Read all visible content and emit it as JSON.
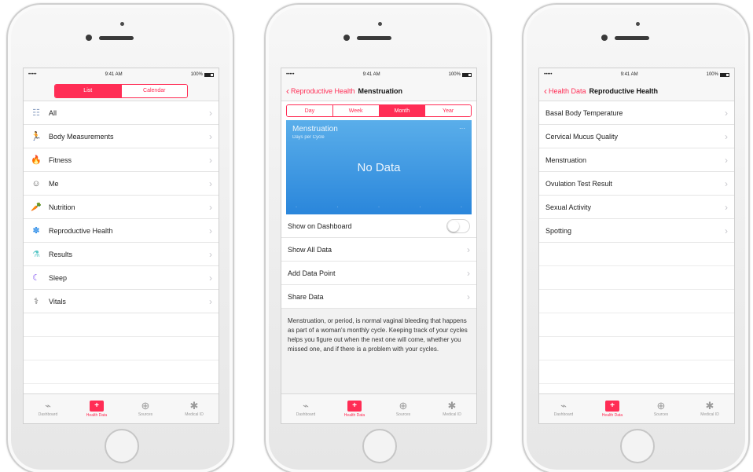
{
  "phone1": {
    "status": {
      "carrier": "•••••",
      "time": "9:41 AM",
      "battery": "100%"
    },
    "segments": [
      {
        "label": "List",
        "active": true
      },
      {
        "label": "Calendar",
        "active": false
      }
    ],
    "categories": [
      {
        "label": "All",
        "icon": "all-icon",
        "glyph": "☷",
        "color": "#8fa3c4"
      },
      {
        "label": "Body Measurements",
        "icon": "body-measurements-icon",
        "glyph": "🏃",
        "color": "#f5a623"
      },
      {
        "label": "Fitness",
        "icon": "fitness-flame-icon",
        "glyph": "🔥",
        "color": "#ff3b30"
      },
      {
        "label": "Me",
        "icon": "me-icon",
        "glyph": "☺",
        "color": "#555555"
      },
      {
        "label": "Nutrition",
        "icon": "nutrition-carrot-icon",
        "glyph": "🥕",
        "color": "#ff9500"
      },
      {
        "label": "Reproductive Health",
        "icon": "reproductive-health-icon",
        "glyph": "✽",
        "color": "#2d8de8"
      },
      {
        "label": "Results",
        "icon": "results-flask-icon",
        "glyph": "⚗",
        "color": "#5ac8c8"
      },
      {
        "label": "Sleep",
        "icon": "sleep-moon-icon",
        "glyph": "☾",
        "color": "#7d4ff0"
      },
      {
        "label": "Vitals",
        "icon": "vitals-stethoscope-icon",
        "glyph": "⚕",
        "color": "#666666"
      }
    ]
  },
  "phone2": {
    "status": {
      "carrier": "•••••",
      "time": "9:41 AM",
      "battery": "100%"
    },
    "back_label": "Reproductive Health",
    "title": "Menstruation",
    "periods": [
      {
        "label": "Day",
        "active": false
      },
      {
        "label": "Week",
        "active": false
      },
      {
        "label": "Month",
        "active": true
      },
      {
        "label": "Year",
        "active": false
      }
    ],
    "chart": {
      "title": "Menstruation",
      "subtitle": "Days per Cycle",
      "no_data": "No Data"
    },
    "rows": {
      "show_on_dashboard": "Show on Dashboard",
      "show_all_data": "Show All Data",
      "add_data_point": "Add Data Point",
      "share_data": "Share Data"
    },
    "description": "Menstruation, or period, is normal vaginal bleeding that happens as part of a woman's monthly cycle. Keeping track of your cycles helps you figure out when the next one will come, whether you missed one, and if there is a problem with your cycles."
  },
  "phone3": {
    "status": {
      "carrier": "•••••",
      "time": "9:41 AM",
      "battery": "100%"
    },
    "back_label": "Health Data",
    "title": "Reproductive Health",
    "items": [
      "Basal Body Temperature",
      "Cervical Mucus Quality",
      "Menstruation",
      "Ovulation Test Result",
      "Sexual Activity",
      "Spotting"
    ]
  },
  "tabs": [
    {
      "label": "Dashboard",
      "icon": "dashboard-icon",
      "glyph": "⌁"
    },
    {
      "label": "Health Data",
      "icon": "health-data-icon",
      "glyph": "+"
    },
    {
      "label": "Sources",
      "icon": "sources-icon",
      "glyph": "⊕"
    },
    {
      "label": "Medical ID",
      "icon": "medical-id-icon",
      "glyph": "✱"
    }
  ],
  "colors": {
    "accent": "#ff2d55",
    "chart_blue": "#2a86db"
  }
}
